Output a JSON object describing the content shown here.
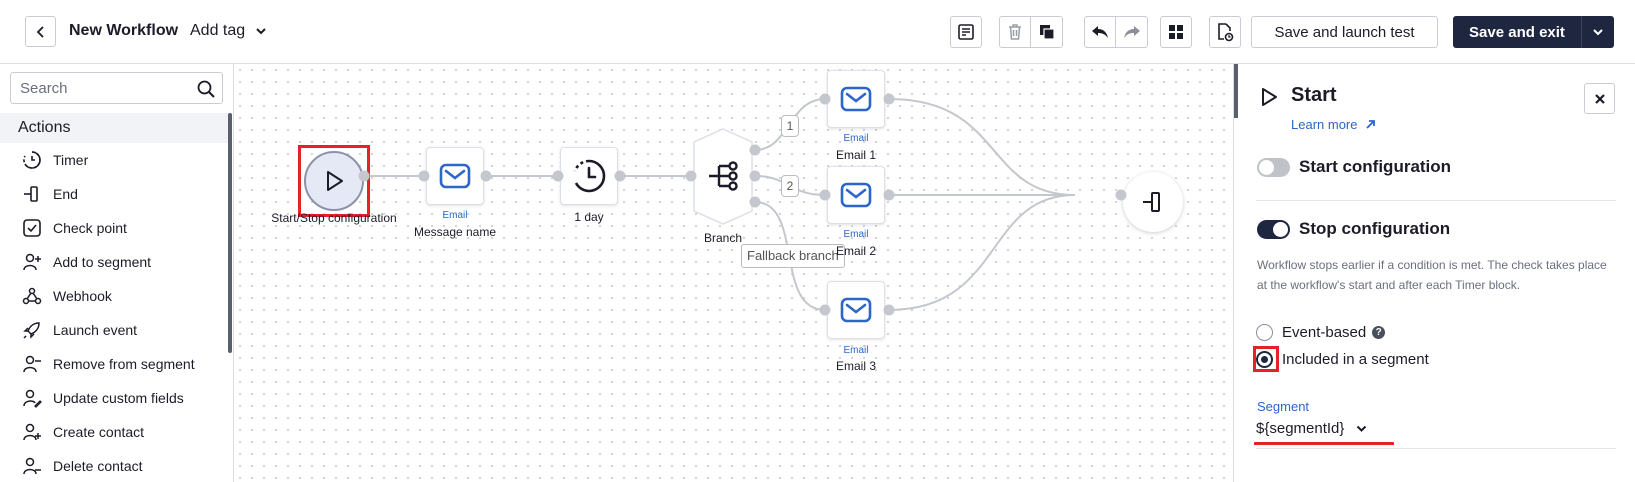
{
  "header": {
    "title": "New Workflow",
    "add_tag": "Add tag",
    "save_launch_test": "Save and launch test",
    "save_exit": "Save and exit"
  },
  "sidebar": {
    "search_placeholder": "Search",
    "section_title": "Actions",
    "items": [
      {
        "label": "Timer",
        "icon": "timer-icon"
      },
      {
        "label": "End",
        "icon": "end-icon"
      },
      {
        "label": "Check point",
        "icon": "check-point-icon"
      },
      {
        "label": "Add to segment",
        "icon": "add-to-segment-icon"
      },
      {
        "label": "Webhook",
        "icon": "webhook-icon"
      },
      {
        "label": "Launch event",
        "icon": "rocket-icon"
      },
      {
        "label": "Remove from segment",
        "icon": "remove-from-segment-icon"
      },
      {
        "label": "Update custom fields",
        "icon": "update-fields-icon"
      },
      {
        "label": "Create contact",
        "icon": "create-contact-icon"
      },
      {
        "label": "Delete contact",
        "icon": "delete-contact-icon"
      }
    ]
  },
  "canvas": {
    "start_label": "Start/Stop configuration",
    "email_type": "Email",
    "message_name": "Message name",
    "timer_label": "1 day",
    "branch_label": "Branch",
    "branch_1": "1",
    "branch_2": "2",
    "fallback_label": "Fallback branch",
    "email_1": "Email 1",
    "email_2": "Email 2",
    "email_3": "Email 3"
  },
  "panel": {
    "title": "Start",
    "learn_more": "Learn more",
    "start_config": "Start configuration",
    "stop_config": "Stop configuration",
    "description": "Workflow stops earlier if a condition is met. The check takes place at the workflow's start and after each Timer block.",
    "radio_event": "Event-based",
    "radio_segment": "Included in a segment",
    "segment_label": "Segment",
    "segment_value": "${segmentId}"
  },
  "colors": {
    "accent_dark": "#1f2640",
    "link_blue": "#2b66c8",
    "highlight_red": "#e8202a",
    "email_icon_blue": "#2b66c8"
  }
}
